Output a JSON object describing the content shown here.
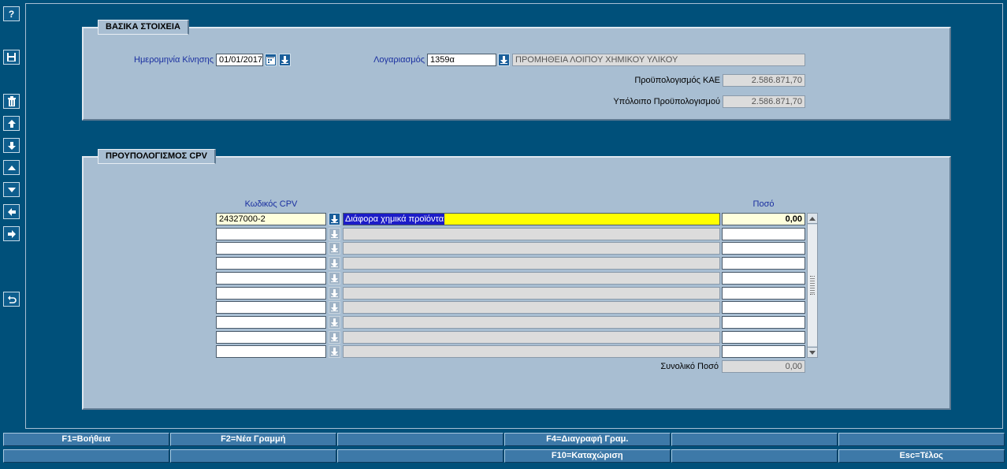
{
  "toolbar": {
    "help_label": "?",
    "items": [
      "help-icon",
      "save-icon",
      "delete-icon",
      "first-record-icon",
      "last-record-icon",
      "previous-record-icon",
      "next-record-icon",
      "previous-block-icon",
      "next-block-icon",
      "undo-icon"
    ]
  },
  "basic": {
    "title": "ΒΑΣΙΚΑ ΣΤΟΙΧΕΙΑ",
    "date_label": "Ημερομηνία Κίνησης",
    "date_value": "01/01/2017",
    "account_label": "Λογαριασμός",
    "account_value": "1359α",
    "account_desc": "ΠΡΟΜΗΘΕΙΑ ΛΟΙΠΟΥ ΧΗΜΙΚΟΥ ΥΛΙΚΟΥ",
    "budget_label": "Προϋπολογισμός ΚΑΕ",
    "budget_value": "2.586.871,70",
    "remaining_label": "Υπόλοιπο Προϋπολογισμού",
    "remaining_value": "2.586.871,70"
  },
  "cpv": {
    "title": "ΠΡΟΥΠΟΛΟΓΙΣΜΟΣ CPV",
    "col_code": "Κωδικός CPV",
    "col_amount": "Ποσό",
    "rows": [
      {
        "code": "24327000-2",
        "desc": "Διάφορα χημικά προϊόντα",
        "amount": "0,00"
      },
      {
        "code": "",
        "desc": "",
        "amount": ""
      },
      {
        "code": "",
        "desc": "",
        "amount": ""
      },
      {
        "code": "",
        "desc": "",
        "amount": ""
      },
      {
        "code": "",
        "desc": "",
        "amount": ""
      },
      {
        "code": "",
        "desc": "",
        "amount": ""
      },
      {
        "code": "",
        "desc": "",
        "amount": ""
      },
      {
        "code": "",
        "desc": "",
        "amount": ""
      },
      {
        "code": "",
        "desc": "",
        "amount": ""
      },
      {
        "code": "",
        "desc": "",
        "amount": ""
      }
    ],
    "total_label": "Συνολικό Ποσό",
    "total_value": "0,00"
  },
  "fkeys": {
    "row1": [
      "F1=Βοήθεια",
      "F2=Νέα Γραμμή",
      "",
      "F4=Διαγραφή Γραμ.",
      "",
      ""
    ],
    "row2": [
      "",
      "",
      "",
      "F10=Καταχώριση",
      "",
      "Esc=Τέλος"
    ]
  },
  "colors": {
    "background": "#00507a",
    "panel": "#a8bed2",
    "label_blue": "#1a2fa0",
    "highlight_yellow": "#ffff00",
    "selection_blue": "#1c1cc8",
    "current_row_field": "#ffffdc"
  }
}
